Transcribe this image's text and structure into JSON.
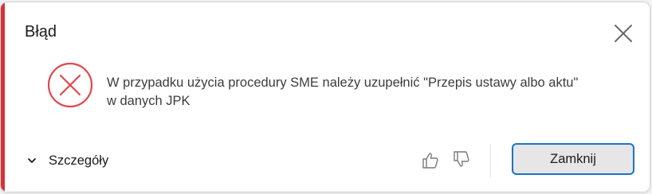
{
  "dialog": {
    "title": "Błąd",
    "message_line1": "W przypadku użycia procedury SME należy uzupełnić \"Przepis ustawy albo aktu\"",
    "message_line2": "w danych JPK",
    "details_label": "Szczegóły",
    "close_button_label": "Zamknij"
  },
  "icons": {
    "error": "error-circle-x-icon",
    "close": "close-icon",
    "chevron": "chevron-down-icon",
    "thumbs_up": "thumbs-up-icon",
    "thumbs_down": "thumbs-down-icon"
  },
  "colors": {
    "accent": "#d13438",
    "error_icon": "#e0474b",
    "primary_border": "#1a73c8"
  }
}
